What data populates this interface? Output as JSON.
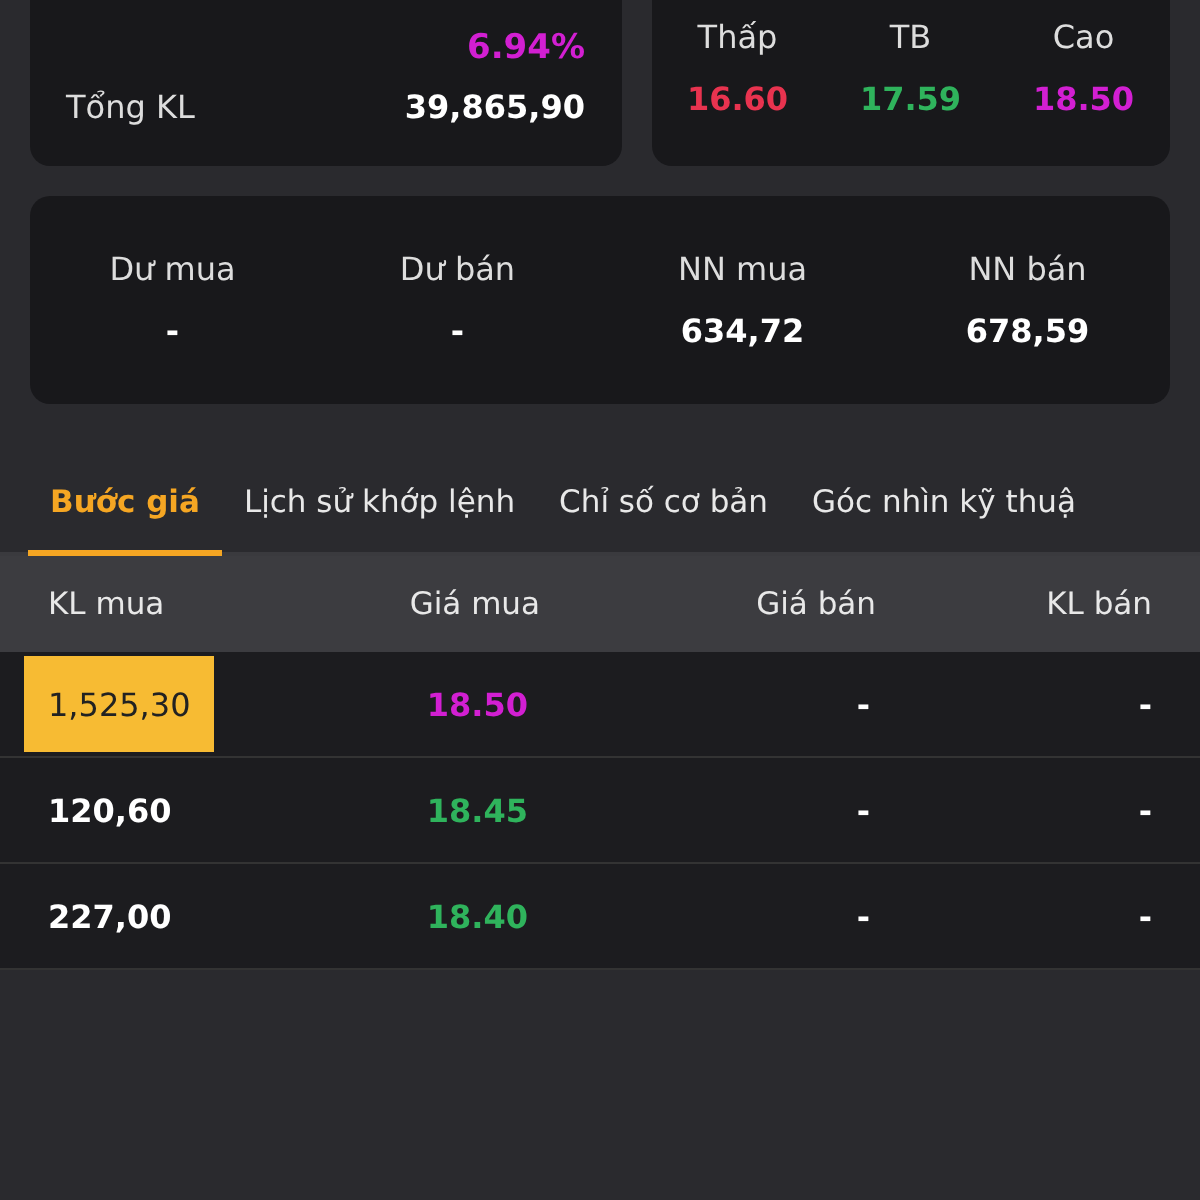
{
  "summary": {
    "change": {
      "value": "6.94%",
      "color": "#d21fd2"
    },
    "total_label": "Tổng KL",
    "total_value": "39,865,90"
  },
  "range": [
    {
      "label": "Thấp",
      "value": "16.60",
      "color": "#e8334f"
    },
    {
      "label": "TB",
      "value": "17.59",
      "color": "#2fb35c"
    },
    {
      "label": "Cao",
      "value": "18.50",
      "color": "#d21fd2"
    }
  ],
  "stats": [
    {
      "label": "Dư mua",
      "value": "-"
    },
    {
      "label": "Dư bán",
      "value": "-"
    },
    {
      "label": "NN mua",
      "value": "634,72"
    },
    {
      "label": "NN bán",
      "value": "678,59"
    }
  ],
  "tabs": [
    {
      "label": "Bước giá",
      "selected": true
    },
    {
      "label": "Lịch sử khớp lệnh",
      "selected": false
    },
    {
      "label": "Chỉ số cơ bản",
      "selected": false
    },
    {
      "label": "Góc nhìn kỹ thuậ",
      "selected": false
    }
  ],
  "table": {
    "columns": [
      "KL mua",
      "Giá mua",
      "Giá bán",
      "KL bán"
    ],
    "rows": [
      {
        "cells": [
          "1,525,30",
          "18.50",
          "-",
          "-"
        ],
        "highlighted": true,
        "color": "#d21fd2"
      },
      {
        "cells": [
          "120,60",
          "18.45",
          "-",
          "-"
        ],
        "highlighted": false,
        "color": "#2fb35c"
      },
      {
        "cells": [
          "227,00",
          "18.40",
          "-",
          "-"
        ],
        "highlighted": false,
        "color": "#2fb35c"
      }
    ]
  }
}
